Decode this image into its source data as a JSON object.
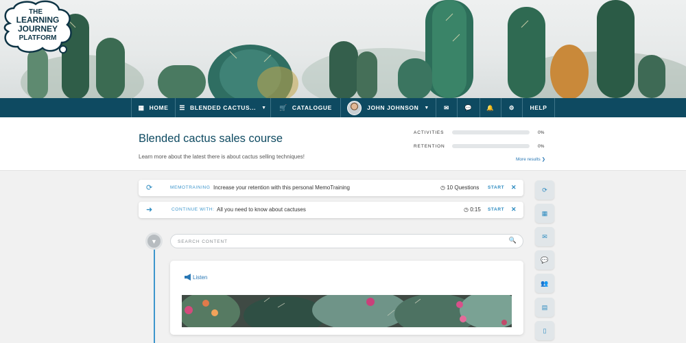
{
  "brand": {
    "logo_lines": [
      "THE",
      "LEARNING",
      "JOURNEY",
      "PLATFORM"
    ]
  },
  "nav": {
    "home": "HOME",
    "course": "BLENDED CACTUS...",
    "catalogue": "CATALOGUE",
    "user": "JOHN JOHNSON",
    "help": "HELP",
    "icons": [
      "grid-icon",
      "list-icon",
      "cart-icon",
      "envelope-icon",
      "chat-icon",
      "bell-icon",
      "gear-icon"
    ]
  },
  "course": {
    "title": "Blended cactus sales course",
    "description": "Learn more about the latest there is about cactus selling techniques!",
    "metrics": [
      {
        "label": "ACTIVITIES",
        "value": "0%",
        "progress": 0
      },
      {
        "label": "RETENTION",
        "value": "0%",
        "progress": 0
      }
    ],
    "more_results": "More results ❯"
  },
  "notices": [
    {
      "tag": "MEMOTRAINING",
      "text": "Increase your retention with this personal MemoTraining",
      "meta": "10 Questions",
      "action": "START",
      "icon": "refresh-icon"
    },
    {
      "tag": "CONTINUE WITH:",
      "text": "All you need to know about cactuses",
      "meta": "0:15",
      "action": "START",
      "icon": "arrow-right-icon"
    }
  ],
  "search": {
    "placeholder": "SEARCH CONTENT"
  },
  "content": {
    "listen_label": "Listen"
  },
  "rail": [
    "refresh-icon",
    "calendar-icon",
    "envelope-icon",
    "chat-icon",
    "users-icon",
    "book-icon",
    "document-icon"
  ],
  "colors": {
    "primary": "#0e4a61",
    "accent": "#2d8bc0",
    "search_icon": "#9cc42f"
  }
}
